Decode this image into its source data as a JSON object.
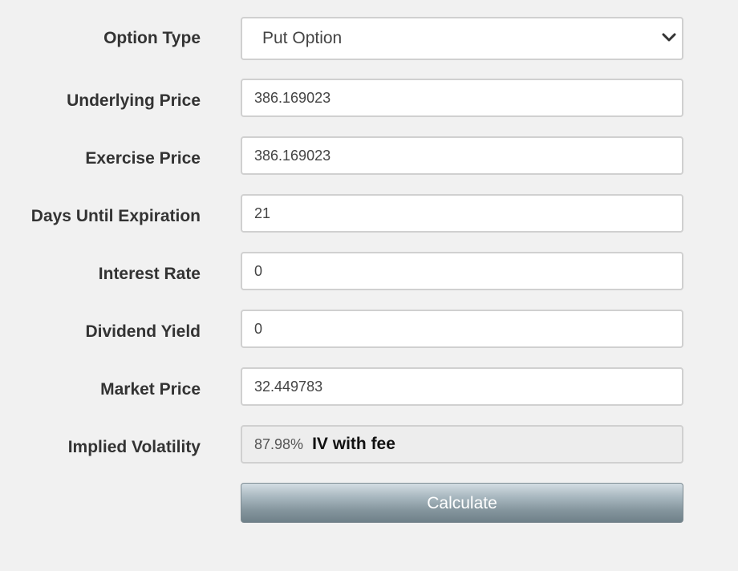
{
  "form": {
    "option_type": {
      "label": "Option Type",
      "selected": "Put Option"
    },
    "underlying_price": {
      "label": "Underlying Price",
      "value": "386.169023"
    },
    "exercise_price": {
      "label": "Exercise Price",
      "value": "386.169023"
    },
    "days_until_expiration": {
      "label": "Days Until Expiration",
      "value": "21"
    },
    "interest_rate": {
      "label": "Interest Rate",
      "value": "0"
    },
    "dividend_yield": {
      "label": "Dividend Yield",
      "value": "0"
    },
    "market_price": {
      "label": "Market Price",
      "value": "32.449783"
    },
    "implied_volatility": {
      "label": "Implied Volatility",
      "value": "87.98%",
      "note": "IV with fee"
    },
    "calculate_label": "Calculate"
  },
  "icons": {
    "select_chevron": "chevron-down-icon"
  },
  "colors": {
    "page_background": "#f1f1f1",
    "label_text": "#333333",
    "field_border": "#d0d0d0",
    "readonly_background": "#ededed",
    "button_gradient_top": "#d3dde3",
    "button_gradient_bottom": "#6f8089"
  }
}
